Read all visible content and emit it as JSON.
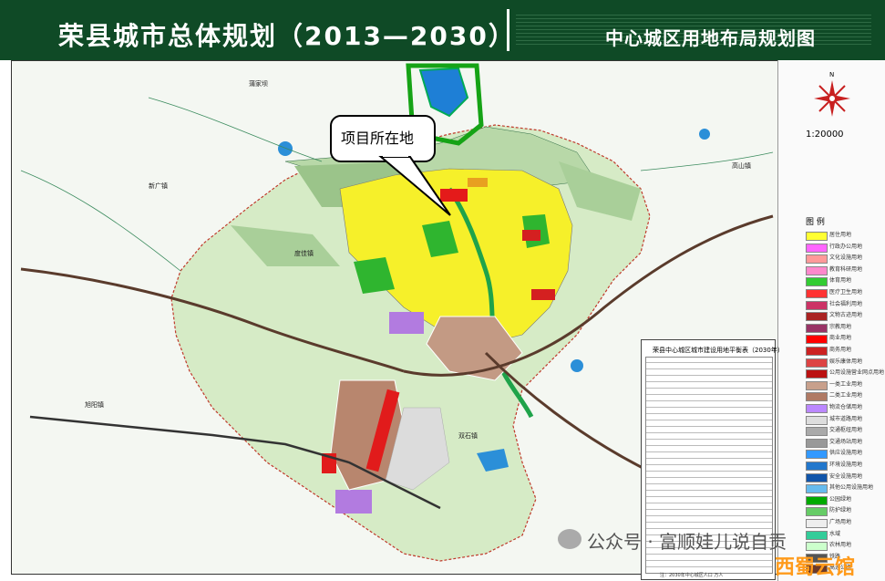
{
  "header": {
    "title": "荣县城市总体规划（2013—2030）",
    "subtitle": "中心城区用地布局规划图"
  },
  "callout": {
    "label": "项目所在地"
  },
  "scale": {
    "text": "1:20000"
  },
  "compass": {
    "label": "N"
  },
  "legend": {
    "title": "图 例",
    "items": [
      {
        "label": "居住用地",
        "color": "#ffff33"
      },
      {
        "label": "行政办公用地",
        "color": "#ff66ff"
      },
      {
        "label": "文化设施用地",
        "color": "#ff9999"
      },
      {
        "label": "教育科研用地",
        "color": "#ff88cc"
      },
      {
        "label": "体育用地",
        "color": "#33cc33"
      },
      {
        "label": "医疗卫生用地",
        "color": "#ff3333"
      },
      {
        "label": "社会福利用地",
        "color": "#cc3366"
      },
      {
        "label": "文物古迹用地",
        "color": "#aa2222"
      },
      {
        "label": "宗教用地",
        "color": "#993366"
      },
      {
        "label": "商业用地",
        "color": "#ff0000"
      },
      {
        "label": "商务用地",
        "color": "#cc2222"
      },
      {
        "label": "娱乐康体用地",
        "color": "#dd4444"
      },
      {
        "label": "公用设施营业网点用地",
        "color": "#bb1111"
      },
      {
        "label": "一类工业用地",
        "color": "#c8a08c"
      },
      {
        "label": "二类工业用地",
        "color": "#b07a64"
      },
      {
        "label": "物流仓储用地",
        "color": "#bb88ff"
      },
      {
        "label": "城市道路用地",
        "color": "#dddddd"
      },
      {
        "label": "交通枢纽用地",
        "color": "#aaaaaa"
      },
      {
        "label": "交通场站用地",
        "color": "#999999"
      },
      {
        "label": "供应设施用地",
        "color": "#3399ff"
      },
      {
        "label": "环境设施用地",
        "color": "#2277cc"
      },
      {
        "label": "安全设施用地",
        "color": "#1155aa"
      },
      {
        "label": "其他公用设施用地",
        "color": "#66bbee"
      },
      {
        "label": "公园绿地",
        "color": "#00aa00"
      },
      {
        "label": "防护绿地",
        "color": "#66cc66"
      },
      {
        "label": "广场用地",
        "color": "#eeeeee"
      },
      {
        "label": "水域",
        "color": "#33cc99"
      },
      {
        "label": "农林用地",
        "color": "#ccffcc"
      },
      {
        "label": "铁路",
        "color": "#555555"
      },
      {
        "label": "高速公路",
        "color": "#6b3a2a"
      }
    ]
  },
  "table": {
    "title": "荣县中心城区城市建设用地平衡表（2030年）",
    "footer": "注：2030年中心城区人口 万人"
  },
  "map_labels": {
    "label1": "蒲家坝",
    "label2": "高山镇",
    "label3": "新广镇",
    "label4": "旭阳镇",
    "label5": "度佳镇",
    "label6": "双石镇"
  },
  "watermark": {
    "text": "公众号 · 富顺娃儿说自贡"
  },
  "corner_logo": {
    "text": "西蜀云馆"
  }
}
